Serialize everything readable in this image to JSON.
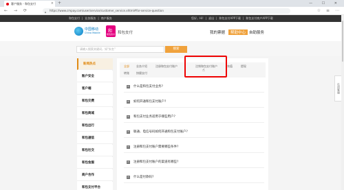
{
  "browser": {
    "tab_title": "客户服务 - 和包支付",
    "new_tab": "+",
    "window_controls": "— ☐ ✕",
    "url": "https://www.cmpay.com/user/service/customer_service.xhtml#for-service-question",
    "nav_back": "←",
    "nav_forward": "→",
    "nav_reload": "⟳",
    "right_icons": "☆ ≡ ⋯"
  },
  "sitebar": {
    "left_links": [
      "和包支付",
      "|",
      "业务服务",
      "|",
      "商户服务"
    ],
    "right_links": [
      "您好，Hi!",
      "|",
      "退出",
      "|",
      "和包支付APP下载",
      "|",
      "和包支付商户APP下载"
    ]
  },
  "header": {
    "logo_cn": "中国移动",
    "logo_en": "China Mobile",
    "logo2_glyph": "和",
    "logo2_sub": "和包支付",
    "brand": "和包支付",
    "nav": [
      "我的票据",
      "帮助中心",
      "自助服务"
    ],
    "active_nav_index": 1
  },
  "search": {
    "placeholder": "请输入搜索关键词，如\"实名\"",
    "button": "搜索"
  },
  "sidebar": {
    "items": [
      "新闻热点",
      "账户安全",
      "客户端",
      "和包交费",
      "和包商城",
      "和包出行",
      "和包通信",
      "和包社交",
      "和包金服",
      "商户合作",
      "和包支付平台"
    ],
    "active_index": 0
  },
  "tabs": {
    "row1": [
      "全部",
      "业务介绍",
      "注册和包支付账户",
      "注销和包支付账户",
      "充值",
      "提现"
    ],
    "row2": [
      "转账",
      "快捷支付"
    ],
    "active": "全部"
  },
  "questions": [
    "什么是和包支付业务?",
    "如何开通和包支付账户?",
    "和包支付业务适用于哪些用户?",
    "联通、电信号码如何开通和包支付账户?",
    "注册和包支付账户需要哪些条件?",
    "注册和包支付账户的渠道有哪些?",
    "什么是付款码?"
  ],
  "question_arrow": ">",
  "side_float": "在线客服",
  "cursor": "☝",
  "colors": {
    "accent": "#f0a23c",
    "highlight": "#e00000",
    "topbar": "#333333"
  }
}
